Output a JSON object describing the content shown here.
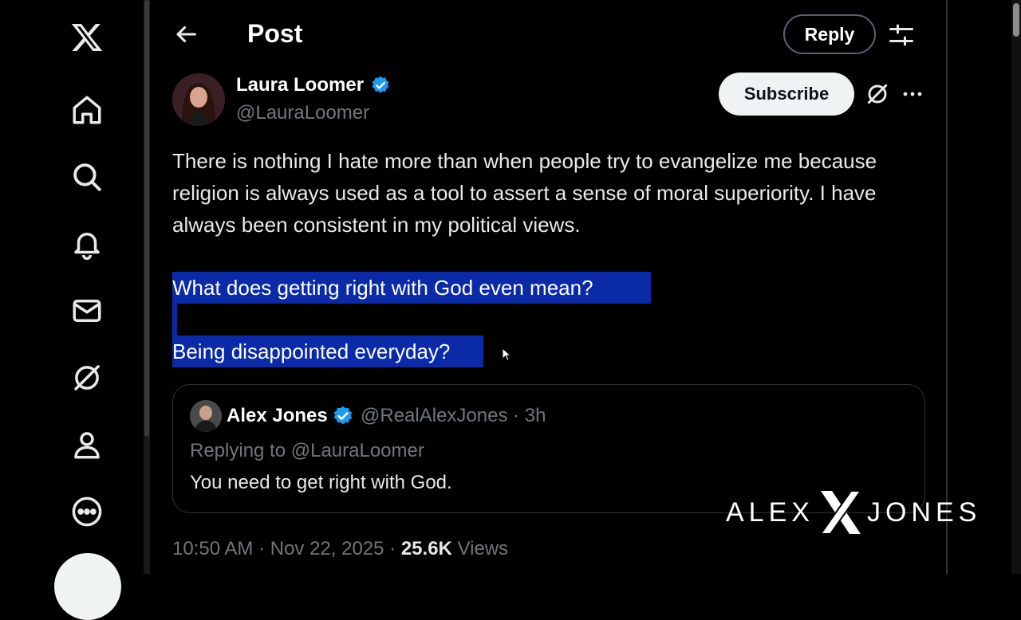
{
  "header": {
    "title": "Post",
    "reply_label": "Reply"
  },
  "author": {
    "name": "Laura Loomer",
    "handle": "@LauraLoomer",
    "subscribe_label": "Subscribe"
  },
  "post": {
    "paragraph": "There is nothing I hate more than when people try to evangelize me because religion is always used as a tool to assert a sense of moral superiority. I have always been consistent in my political views.",
    "highlight_line_1": "What does getting right with God even mean?",
    "highlight_line_2": "Being disappointed everyday?"
  },
  "quoted": {
    "name": "Alex Jones",
    "meta": "@RealAlexJones · 3h",
    "replying_to": "Replying to @LauraLoomer",
    "text": "You need to get right with God."
  },
  "footer": {
    "time": "10:50 AM · Nov 22, 2025 · ",
    "views_count": "25.6K",
    "views_label": " Views"
  },
  "watermark": {
    "left": "ALEX",
    "right": "JONES"
  },
  "colors": {
    "background": "#000000",
    "verified": "#1d9bf0",
    "highlight": "#0a2aa8",
    "muted": "#71767b"
  },
  "icons": [
    "x-logo-icon",
    "home-icon",
    "search-icon",
    "bell-icon",
    "mail-icon",
    "grok-icon",
    "profile-icon",
    "more-circle-icon",
    "back-arrow-icon",
    "filter-icon",
    "verified-icon",
    "ellipsis-icon"
  ]
}
